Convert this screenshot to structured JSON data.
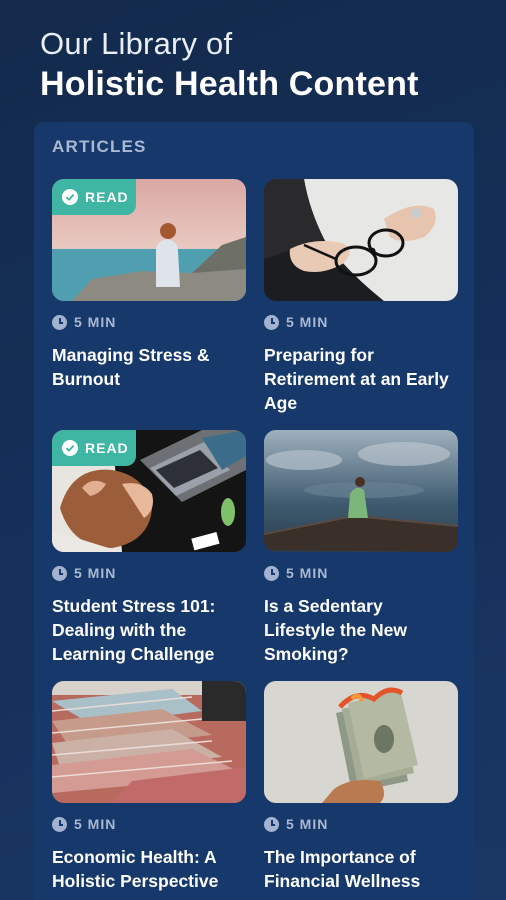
{
  "header": {
    "line1": "Our Library of",
    "line2": "Holistic Health Content"
  },
  "section": {
    "label": "ARTICLES"
  },
  "colors": {
    "background": "#132a4c",
    "panel": "#17386a",
    "badge": "#3fb5a3",
    "muted_text": "#a9b8d3"
  },
  "articles": [
    {
      "title": "Managing Stress & Burnout",
      "duration": "5 MIN",
      "badge": "READ",
      "image": "woman-sitting-on-cliff-by-sea"
    },
    {
      "title": "Preparing for Retirement at an Early Age",
      "duration": "5 MIN",
      "badge": "",
      "image": "hands-holding-eyeglasses"
    },
    {
      "title": "Student Stress 101: Dealing with the Learning Challenge",
      "duration": "5 MIN",
      "badge": "READ",
      "image": "stressed-student-at-laptop"
    },
    {
      "title": "Is a Sedentary Lifestyle the New Smoking?",
      "duration": "5 MIN",
      "badge": "",
      "image": "person-sitting-on-pier-by-water"
    },
    {
      "title": "Economic Health: A Holistic Perspective",
      "duration": "5 MIN",
      "badge": "",
      "image": "stacks-of-banknotes"
    },
    {
      "title": "The Importance of Financial Wellness",
      "duration": "5 MIN",
      "badge": "",
      "image": "burning-dollar-bills"
    }
  ]
}
